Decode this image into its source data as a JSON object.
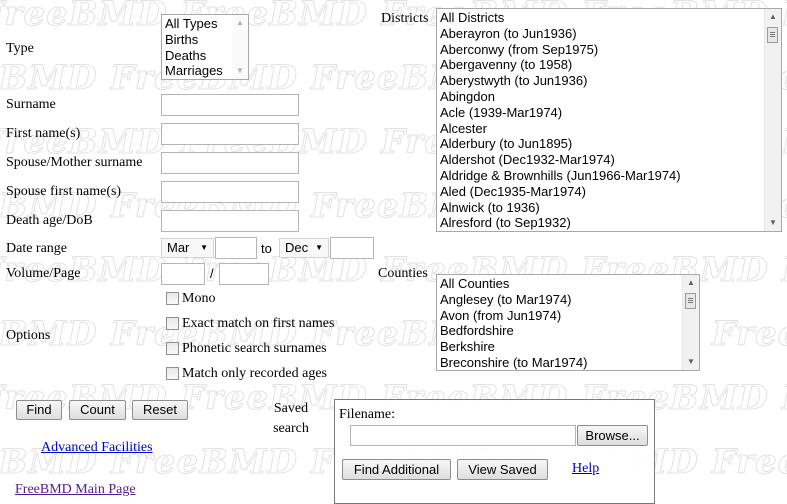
{
  "watermark": "FreeBMD",
  "type": {
    "label": "Type",
    "options": [
      "All Types",
      "Births",
      "Deaths",
      "Marriages"
    ]
  },
  "districts": {
    "label": "Districts",
    "options": [
      "All Districts",
      "Aberayron (to Jun1936)",
      "Aberconwy (from Sep1975)",
      "Abergavenny (to 1958)",
      "Aberystwyth (to Jun1936)",
      "Abingdon",
      "Acle (1939-Mar1974)",
      "Alcester",
      "Alderbury (to Jun1895)",
      "Aldershot (Dec1932-Mar1974)",
      "Aldridge & Brownhills (Jun1966-Mar1974)",
      "Aled (Dec1935-Mar1974)",
      "Alnwick (to 1936)",
      "Alresford (to Sep1932)"
    ]
  },
  "fields": {
    "surname_label": "Surname",
    "first_names_label": "First name(s)",
    "spouse_surname_label": "Spouse/Mother surname",
    "spouse_first_label": "Spouse first name(s)",
    "death_age_label": "Death age/DoB",
    "surname_value": "",
    "first_names_value": "",
    "spouse_surname_value": "",
    "spouse_first_value": "",
    "death_age_value": ""
  },
  "date_range": {
    "label": "Date range",
    "start_month": "Mar",
    "to_label": "to",
    "end_month": "Dec",
    "start_year": "",
    "end_year": ""
  },
  "volume_page": {
    "label": "Volume/Page",
    "separator": "/"
  },
  "counties": {
    "label": "Counties",
    "options": [
      "All Counties",
      "Anglesey (to Mar1974)",
      "Avon (from Jun1974)",
      "Bedfordshire",
      "Berkshire",
      "Breconshire (to Mar1974)"
    ]
  },
  "options": {
    "label": "Options",
    "mono": "Mono",
    "exact_match": "Exact match on first names",
    "phonetic": "Phonetic search surnames",
    "recorded_ages": "Match only recorded ages"
  },
  "actions": {
    "find": "Find",
    "count": "Count",
    "reset": "Reset"
  },
  "saved_search": {
    "label_line1": "Saved",
    "label_line2": "search",
    "filename_label": "Filename:",
    "browse": "Browse...",
    "find_additional": "Find Additional",
    "view_saved": "View Saved",
    "help": "Help"
  },
  "links": {
    "advanced": "Advanced Facilities",
    "main_page": "FreeBMD Main Page"
  },
  "colors": {
    "link": "#0000cc",
    "visited_link": "#551a8b",
    "watermark": "#e2e2e2"
  }
}
